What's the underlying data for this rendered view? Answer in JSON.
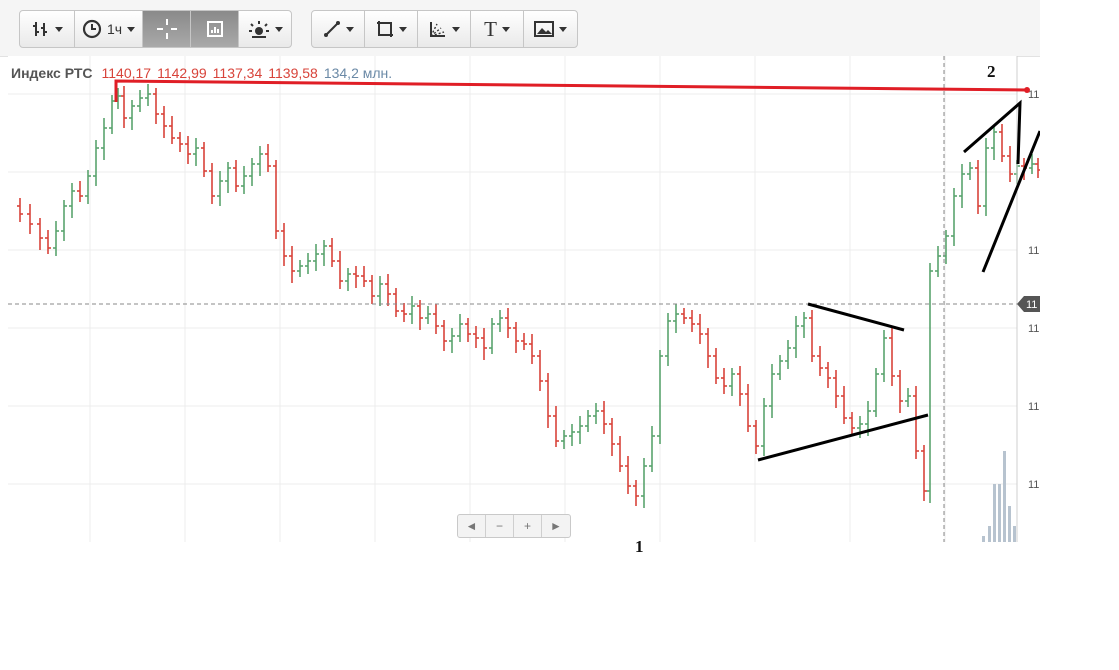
{
  "toolbar": {
    "groups": [
      {
        "name": "chart-type-group",
        "buttons": [
          {
            "name": "bar-type-button",
            "icon": "ohlc-bars-icon",
            "label": "",
            "caret": true,
            "active": false
          },
          {
            "name": "interval-button",
            "icon": "clock-icon",
            "label": "1ч",
            "caret": true,
            "active": false
          },
          {
            "name": "crosshair-button",
            "icon": "crosshair-icon",
            "label": "",
            "caret": false,
            "active": true
          },
          {
            "name": "volume-panel-button",
            "icon": "panel-icon",
            "label": "",
            "caret": false,
            "active": true
          },
          {
            "name": "indicators-button",
            "icon": "sun-icon",
            "label": "",
            "caret": true,
            "active": false
          }
        ]
      },
      {
        "name": "drawing-tools-group",
        "buttons": [
          {
            "name": "line-tool-button",
            "icon": "trend-line-icon",
            "label": "",
            "caret": true,
            "active": false
          },
          {
            "name": "shape-tool-button",
            "icon": "rectangle-icon",
            "label": "",
            "caret": true,
            "active": false
          },
          {
            "name": "fibonacci-tool-button",
            "icon": "fan-icon",
            "label": "",
            "caret": true,
            "active": false
          },
          {
            "name": "text-tool-button",
            "icon": "text-icon",
            "label": "T",
            "caret": true,
            "active": false
          },
          {
            "name": "image-tool-button",
            "icon": "image-icon",
            "label": "",
            "caret": true,
            "active": false
          }
        ]
      }
    ]
  },
  "legend": {
    "instrument": "Индекс РТС",
    "open": "1140,17",
    "high": "1142,99",
    "low": "1137,34",
    "close": "1139,58",
    "volume": "134,2 млн."
  },
  "navigator": {
    "buttons": [
      "◄",
      "−",
      "+",
      "►"
    ]
  },
  "annotations": {
    "label_1": "1",
    "label_2": "2"
  },
  "colors": {
    "up": "#5aa36e",
    "down": "#d8433a",
    "annotation_line": "#e01e26",
    "drawing": "#000000",
    "volume": "#b7c3cf",
    "grid": "#ececec"
  },
  "chart_data": {
    "type": "ohlc",
    "title": "Индекс РТС",
    "interval": "1ч",
    "y_tick_labels": [
      "11",
      "11",
      "11",
      "11",
      "11"
    ],
    "current_price_label": "11",
    "grid": true,
    "bars_x_to_y_note": "",
    "bars": [
      [
        0,
        0.3,
        0.0,
        0.36,
        0.34
      ],
      [
        1,
        0.34,
        0.3,
        0.39,
        0.33
      ],
      [
        2,
        0.33,
        0.31,
        0.4,
        0.38
      ],
      [
        3,
        0.38,
        0.36,
        0.42,
        0.4
      ],
      [
        4,
        0.4,
        0.38,
        0.45,
        0.44
      ],
      [
        5,
        0.44,
        0.4,
        0.46,
        0.43
      ],
      [
        6,
        0.43,
        0.37,
        0.44,
        0.39
      ],
      [
        7,
        0.39,
        0.33,
        0.4,
        0.35
      ],
      [
        8,
        0.35,
        0.27,
        0.36,
        0.29
      ],
      [
        9,
        0.29,
        0.26,
        0.33,
        0.31
      ],
      [
        10,
        0.31,
        0.24,
        0.32,
        0.26
      ],
      [
        11,
        0.26,
        0.22,
        0.29,
        0.27
      ],
      [
        12,
        0.27,
        0.23,
        0.3,
        0.24
      ],
      [
        13,
        0.24,
        0.14,
        0.25,
        0.16
      ],
      [
        14,
        0.16,
        0.1,
        0.18,
        0.17
      ],
      [
        15,
        0.17,
        0.12,
        0.2,
        0.13
      ],
      [
        16,
        0.13,
        0.05,
        0.14,
        0.07
      ],
      [
        17,
        0.07,
        0.03,
        0.11,
        0.09
      ],
      [
        18,
        0.09,
        0.02,
        0.12,
        0.04
      ],
      [
        19,
        0.04,
        0.0,
        0.08,
        0.06
      ],
      [
        20,
        0.06,
        0.01,
        0.11,
        0.09
      ],
      [
        21,
        0.09,
        0.05,
        0.14,
        0.12
      ],
      [
        22,
        0.12,
        0.09,
        0.17,
        0.15
      ],
      [
        23,
        0.15,
        0.1,
        0.18,
        0.16
      ],
      [
        24,
        0.16,
        0.12,
        0.22,
        0.19
      ],
      [
        25,
        0.19,
        0.15,
        0.24,
        0.22
      ],
      [
        26,
        0.22,
        0.19,
        0.27,
        0.25
      ],
      [
        27,
        0.25,
        0.19,
        0.26,
        0.21
      ],
      [
        28,
        0.21,
        0.15,
        0.23,
        0.17
      ],
      [
        29,
        0.17,
        0.11,
        0.2,
        0.14
      ],
      [
        30,
        0.14,
        0.09,
        0.18,
        0.15
      ],
      [
        31,
        0.15,
        0.13,
        0.24,
        0.21
      ],
      [
        32,
        0.21,
        0.17,
        0.26,
        0.19
      ],
      [
        33,
        0.19,
        0.13,
        0.2,
        0.16
      ],
      [
        34,
        0.16,
        0.12,
        0.2,
        0.18
      ]
    ]
  }
}
